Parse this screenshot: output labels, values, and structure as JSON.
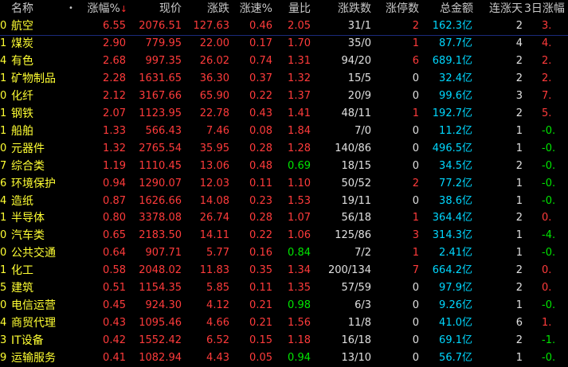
{
  "header": {
    "name": "名称",
    "dot": "•",
    "pct": "涨幅%",
    "sort_arrow": "↓",
    "price": "现价",
    "chg": "涨跌",
    "speed": "涨速%",
    "vr": "量比",
    "updown": "涨跌数",
    "limit": "涨停数",
    "amount": "总金额",
    "streak": "连涨天",
    "d3": "3日涨幅"
  },
  "colors": {
    "red": "#ff3b3b",
    "green": "#00e600",
    "white": "#e0e0e0",
    "cyan": "#00d8ff",
    "yellow": "#ffff33",
    "header": "#c8c8c8"
  },
  "rows": [
    {
      "idx": "0",
      "name": "航空",
      "pct": "6.55",
      "price": "2076.51",
      "chg": "127.63",
      "speed": "0.46",
      "vr": "2.05",
      "updown": "31/1",
      "limit": "2",
      "amount": "162.3",
      "unit": "亿",
      "streak": "2",
      "d3": "3."
    },
    {
      "idx": "1",
      "name": "煤炭",
      "pct": "2.90",
      "price": "779.95",
      "chg": "22.00",
      "speed": "0.17",
      "vr": "1.70",
      "updown": "35/0",
      "limit": "1",
      "amount": "87.7",
      "unit": "亿",
      "streak": "4",
      "d3": "4."
    },
    {
      "idx": "4",
      "name": "有色",
      "pct": "2.68",
      "price": "997.35",
      "chg": "26.02",
      "speed": "0.74",
      "vr": "1.31",
      "updown": "94/20",
      "limit": "6",
      "amount": "689.1",
      "unit": "亿",
      "streak": "2",
      "d3": "2."
    },
    {
      "idx": "1",
      "name": "矿物制品",
      "pct": "2.28",
      "price": "1631.65",
      "chg": "36.30",
      "speed": "0.37",
      "vr": "1.32",
      "updown": "15/5",
      "limit": "0",
      "amount": "32.4",
      "unit": "亿",
      "streak": "2",
      "d3": "2."
    },
    {
      "idx": "0",
      "name": "化纤",
      "pct": "2.12",
      "price": "3167.66",
      "chg": "65.90",
      "speed": "0.22",
      "vr": "1.37",
      "updown": "20/9",
      "limit": "0",
      "amount": "99.6",
      "unit": "亿",
      "streak": "3",
      "d3": "7."
    },
    {
      "idx": "1",
      "name": "钢铁",
      "pct": "2.07",
      "price": "1123.95",
      "chg": "22.78",
      "speed": "0.43",
      "vr": "1.41",
      "updown": "48/11",
      "limit": "1",
      "amount": "192.7",
      "unit": "亿",
      "streak": "2",
      "d3": "5."
    },
    {
      "idx": "1",
      "name": "船舶",
      "pct": "1.33",
      "price": "566.43",
      "chg": "7.46",
      "speed": "0.08",
      "vr": "1.84",
      "updown": "7/0",
      "limit": "0",
      "amount": "11.2",
      "unit": "亿",
      "streak": "1",
      "d3": "-0."
    },
    {
      "idx": "0",
      "name": "元器件",
      "pct": "1.32",
      "price": "2765.54",
      "chg": "35.95",
      "speed": "0.28",
      "vr": "1.28",
      "updown": "140/86",
      "limit": "0",
      "amount": "496.5",
      "unit": "亿",
      "streak": "1",
      "d3": "-0."
    },
    {
      "idx": "7",
      "name": "综合类",
      "pct": "1.19",
      "price": "1110.45",
      "chg": "13.06",
      "speed": "0.48",
      "vr": "0.69",
      "updown": "18/15",
      "limit": "0",
      "amount": "34.5",
      "unit": "亿",
      "streak": "2",
      "d3": "-0."
    },
    {
      "idx": "6",
      "name": "环境保护",
      "pct": "0.94",
      "price": "1290.07",
      "chg": "12.03",
      "speed": "0.11",
      "vr": "1.10",
      "updown": "50/52",
      "limit": "2",
      "amount": "77.2",
      "unit": "亿",
      "streak": "1",
      "d3": "-0."
    },
    {
      "idx": "4",
      "name": "造纸",
      "pct": "0.87",
      "price": "1626.66",
      "chg": "14.08",
      "speed": "0.23",
      "vr": "1.53",
      "updown": "19/11",
      "limit": "0",
      "amount": "38.6",
      "unit": "亿",
      "streak": "1",
      "d3": "-0."
    },
    {
      "idx": "1",
      "name": "半导体",
      "pct": "0.80",
      "price": "3378.08",
      "chg": "26.74",
      "speed": "0.28",
      "vr": "1.07",
      "updown": "56/18",
      "limit": "1",
      "amount": "364.4",
      "unit": "亿",
      "streak": "2",
      "d3": "0."
    },
    {
      "idx": "0",
      "name": "汽车类",
      "pct": "0.65",
      "price": "2183.50",
      "chg": "14.11",
      "speed": "0.22",
      "vr": "1.06",
      "updown": "125/86",
      "limit": "3",
      "amount": "314.3",
      "unit": "亿",
      "streak": "1",
      "d3": "-4."
    },
    {
      "idx": "0",
      "name": "公共交通",
      "pct": "0.64",
      "price": "907.71",
      "chg": "5.77",
      "speed": "0.16",
      "vr": "0.84",
      "updown": "7/2",
      "limit": "1",
      "amount": "2.41",
      "unit": "亿",
      "streak": "1",
      "d3": "-0."
    },
    {
      "idx": "1",
      "name": "化工",
      "pct": "0.58",
      "price": "2048.02",
      "chg": "11.83",
      "speed": "0.35",
      "vr": "1.34",
      "updown": "200/134",
      "limit": "7",
      "amount": "664.2",
      "unit": "亿",
      "streak": "2",
      "d3": "0."
    },
    {
      "idx": "5",
      "name": "建筑",
      "pct": "0.51",
      "price": "1154.35",
      "chg": "5.85",
      "speed": "0.11",
      "vr": "1.35",
      "updown": "57/59",
      "limit": "0",
      "amount": "97.9",
      "unit": "亿",
      "streak": "2",
      "d3": "0."
    },
    {
      "idx": "0",
      "name": "电信运营",
      "pct": "0.45",
      "price": "924.30",
      "chg": "4.12",
      "speed": "0.21",
      "vr": "0.98",
      "updown": "6/3",
      "limit": "0",
      "amount": "9.26",
      "unit": "亿",
      "streak": "1",
      "d3": "-0."
    },
    {
      "idx": "4",
      "name": "商贸代理",
      "pct": "0.43",
      "price": "1095.46",
      "chg": "4.66",
      "speed": "0.21",
      "vr": "1.56",
      "updown": "11/8",
      "limit": "0",
      "amount": "41.0",
      "unit": "亿",
      "streak": "6",
      "d3": "1."
    },
    {
      "idx": "3",
      "name": "IT设备",
      "pct": "0.42",
      "price": "1552.42",
      "chg": "6.52",
      "speed": "0.15",
      "vr": "1.18",
      "updown": "16/18",
      "limit": "0",
      "amount": "69.1",
      "unit": "亿",
      "streak": "2",
      "d3": "-1."
    },
    {
      "idx": "9",
      "name": "运输服务",
      "pct": "0.41",
      "price": "1082.94",
      "chg": "4.43",
      "speed": "0.05",
      "vr": "0.94",
      "updown": "13/10",
      "limit": "0",
      "amount": "56.7",
      "unit": "亿",
      "streak": "1",
      "d3": "-0."
    }
  ]
}
